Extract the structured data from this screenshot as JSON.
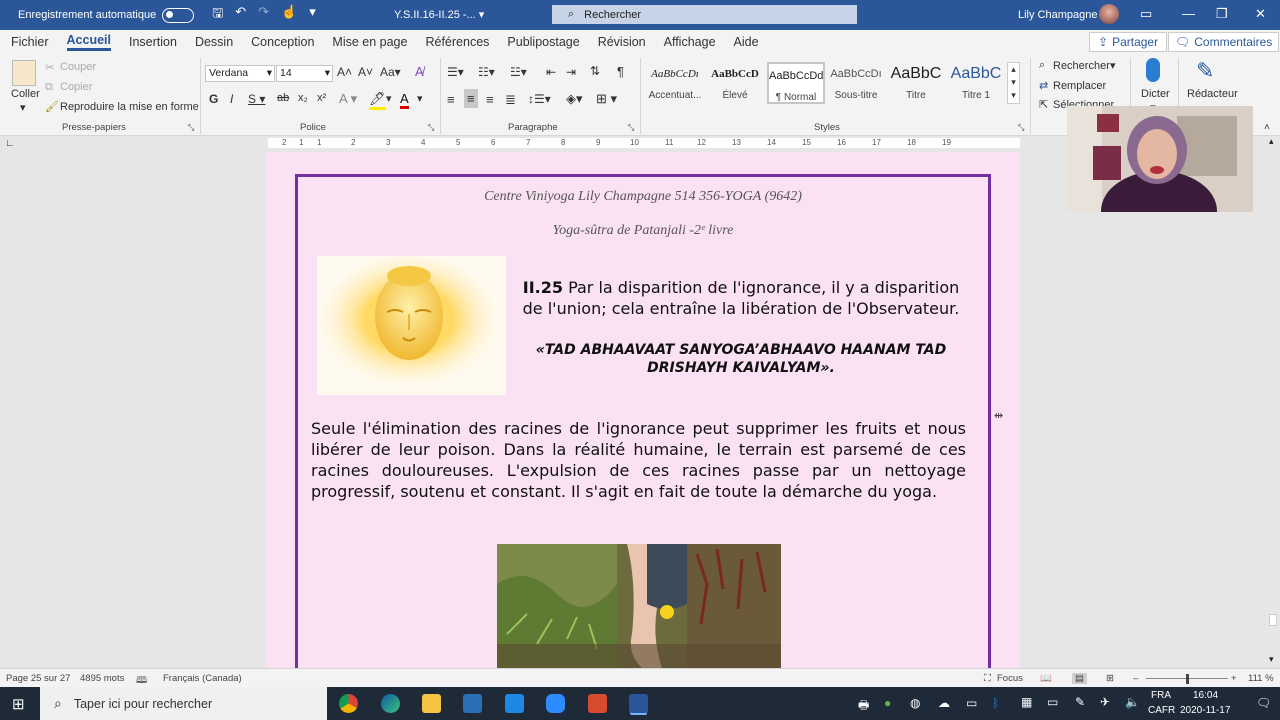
{
  "titlebar": {
    "autosave_label": "Enregistrement automatique",
    "doc_title": "Y.S.II.16-II.25  -...",
    "search_placeholder": "Rechercher",
    "user_name": "Lily Champagne"
  },
  "menu": {
    "tabs": [
      "Fichier",
      "Accueil",
      "Insertion",
      "Dessin",
      "Conception",
      "Mise en page",
      "Références",
      "Publipostage",
      "Révision",
      "Affichage",
      "Aide"
    ],
    "active": "Accueil",
    "share_label": "Partager",
    "comments_label": "Commentaires"
  },
  "ribbon": {
    "clipboard": {
      "paste": "Coller",
      "cut": "Couper",
      "copy": "Copier",
      "format_painter": "Reproduire la mise en forme",
      "group": "Presse-papiers"
    },
    "font": {
      "name": "Verdana",
      "size": "14",
      "group": "Police"
    },
    "paragraph": {
      "group": "Paragraphe"
    },
    "styles": {
      "group": "Styles",
      "items": [
        {
          "preview": "AaBbCcDı",
          "name": "Accentuat..."
        },
        {
          "preview": "AaBbCcD",
          "name": "Élevé"
        },
        {
          "preview": "AaBbCcDd",
          "name": "¶ Normal"
        },
        {
          "preview": "AaBbCcDı",
          "name": "Sous-titre"
        },
        {
          "preview": "AaBbC",
          "name": "Titre"
        },
        {
          "preview": "AaBbC",
          "name": "Titre 1"
        }
      ]
    },
    "editing": {
      "find": "Rechercher",
      "replace": "Remplacer",
      "select": "Sélectionner"
    },
    "voice": {
      "dictate": "Dicter"
    },
    "editor": {
      "label": "Rédacteur"
    }
  },
  "ruler": {
    "numbers": [
      "2",
      "1",
      "1",
      "2",
      "3",
      "4",
      "5",
      "6",
      "7",
      "8",
      "9",
      "10",
      "11",
      "12",
      "13",
      "14",
      "15",
      "16",
      "17",
      "18",
      "19"
    ]
  },
  "document": {
    "header_line1": "Centre Viniyoga Lily Champagne 514 356-YOGA (9642)",
    "header_line2": "Yoga-sûtra de Patanjali -2ᵉ livre",
    "sutra_number": "II.25",
    "sutra_text": " Par la disparition de l'ignorance, il y a disparition de l'union; cela entraîne la libération de l'Observateur.",
    "sanskrit": "«TAD ABHAAVAAT SANYOGA’ABHAAVO HAANAM TAD DRISHAYH KAIVALYAM».",
    "body": "Seule l'élimination des racines de l'ignorance peut supprimer les fruits et nous libérer de leur poison.  Dans la réalité humaine, le terrain est parsemé de ces racines douloureuses.  L'expulsion de ces racines passe par un nettoyage progressif, soutenu et constant.  Il s'agit en fait de toute la démarche du yoga."
  },
  "statusbar": {
    "page": "Page 25 sur 27",
    "words": "4895 mots",
    "language": "Français (Canada)",
    "focus": "Focus",
    "zoom": "111 %"
  },
  "taskbar": {
    "search_placeholder": "Taper ici pour rechercher",
    "lang1": "FRA",
    "lang2": "CAFR",
    "time": "16:04",
    "date": "2020-11-17"
  }
}
